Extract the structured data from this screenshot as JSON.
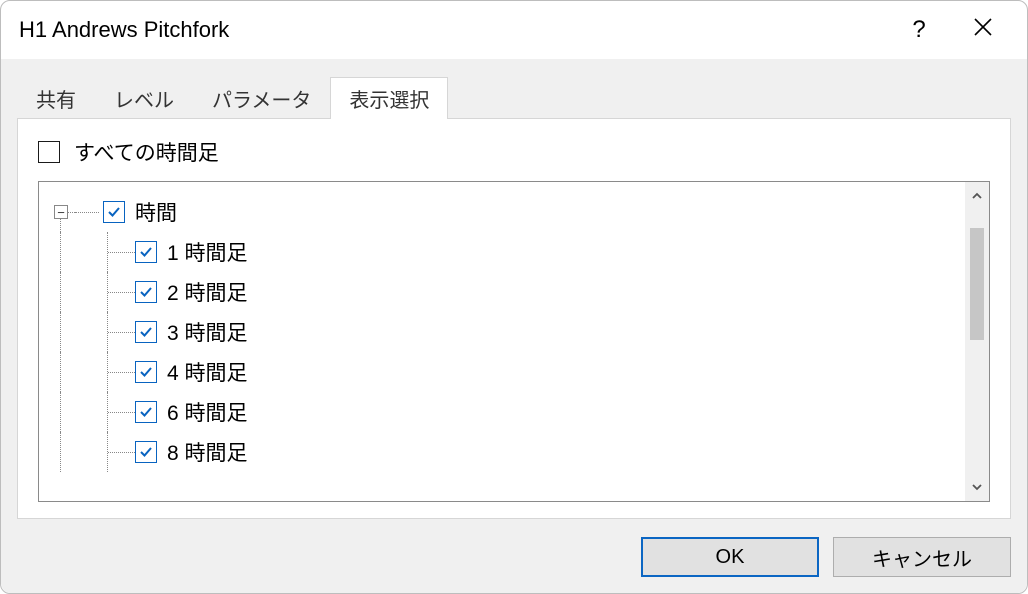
{
  "title": "H1 Andrews Pitchfork",
  "tabs": [
    {
      "label": "共有",
      "active": false
    },
    {
      "label": "レベル",
      "active": false
    },
    {
      "label": "パラメータ",
      "active": false
    },
    {
      "label": "表示選択",
      "active": true
    }
  ],
  "all_timeframes_label": "すべての時間足",
  "all_timeframes_checked": false,
  "tree": {
    "root": {
      "label": "時間",
      "checked": true,
      "expanded": true
    },
    "children": [
      {
        "label": "1 時間足",
        "checked": true
      },
      {
        "label": "2 時間足",
        "checked": true
      },
      {
        "label": "3 時間足",
        "checked": true
      },
      {
        "label": "4 時間足",
        "checked": true
      },
      {
        "label": "6 時間足",
        "checked": true
      },
      {
        "label": "8 時間足",
        "checked": true
      }
    ]
  },
  "buttons": {
    "ok": "OK",
    "cancel": "キャンセル"
  },
  "icons": {
    "help": "?",
    "expander_minus": "−"
  },
  "colors": {
    "checkbox_blue": "#0863c0",
    "button_primary_border": "#0b66c3"
  }
}
